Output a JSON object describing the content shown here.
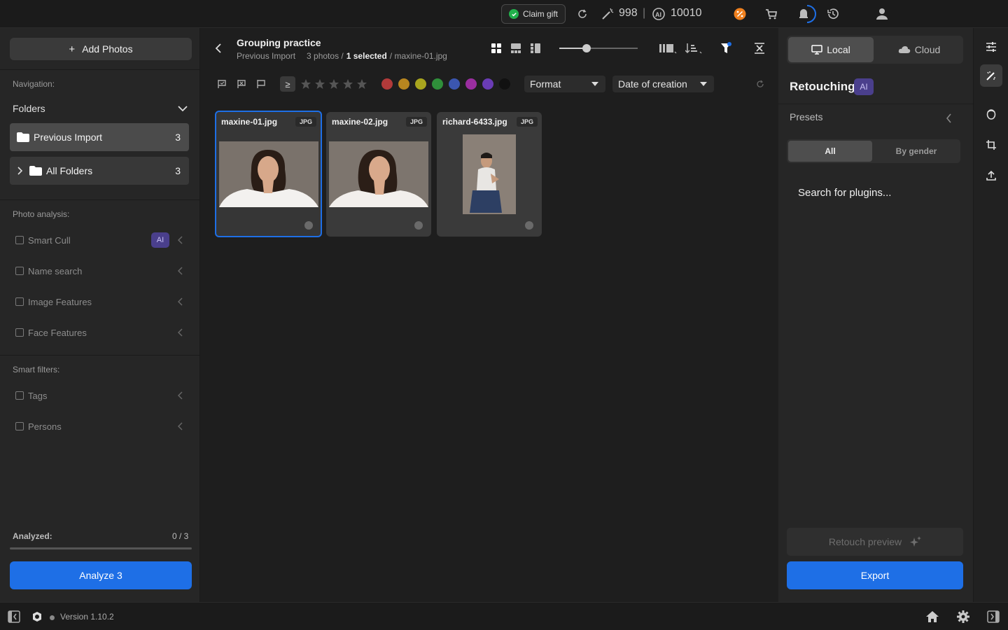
{
  "topbar": {
    "claim_gift": "Claim gift",
    "credits_magic": "998",
    "separator": "|",
    "credits_ai": "10010"
  },
  "left": {
    "add_photos": "Add Photos",
    "navigation_label": "Navigation:",
    "folders_label": "Folders",
    "folders": [
      {
        "label": "Previous Import",
        "count": "3"
      },
      {
        "label": "All Folders",
        "count": "3"
      }
    ],
    "photo_analysis_label": "Photo analysis:",
    "analysis_items": [
      {
        "label": "Smart Cull",
        "badge": "AI"
      },
      {
        "label": "Name search"
      },
      {
        "label": "Image Features"
      },
      {
        "label": "Face Features"
      }
    ],
    "smart_filters_label": "Smart filters:",
    "filter_items": [
      {
        "label": "Tags"
      },
      {
        "label": "Persons"
      }
    ],
    "analyzed_label": "Analyzed:",
    "analyzed_value": "0 / 3",
    "analyzed_progress": 0,
    "analyze_button": "Analyze 3"
  },
  "center": {
    "title": "Grouping practice",
    "breadcrumb_folder": "Previous Import",
    "photos_count": "3 photos /",
    "selected_count": "1 selected",
    "selected_file": "/ maxine-01.jpg",
    "ge_symbol": "≥",
    "format_dropdown": "Format",
    "sort_dropdown": "Date of creation",
    "color_labels": [
      "#b23a3a",
      "#b8861f",
      "#a8a51e",
      "#2f8f3a",
      "#3b56b0",
      "#9b2ea0",
      "#6a3cb5",
      "#111111"
    ],
    "photos": [
      {
        "name": "maxine-01.jpg",
        "format": "JPG",
        "selected": true
      },
      {
        "name": "maxine-02.jpg",
        "format": "JPG",
        "selected": false
      },
      {
        "name": "richard-6433.jpg",
        "format": "JPG",
        "selected": false
      }
    ]
  },
  "right": {
    "local_tab": "Local",
    "cloud_tab": "Cloud",
    "retouching_title": "Retouching",
    "retouching_badge": "AI",
    "presets_label": "Presets",
    "segment_all": "All",
    "segment_gender": "By gender",
    "search_plugins": "Search for plugins...",
    "retouch_preview": "Retouch preview",
    "export_button": "Export"
  },
  "bottombar": {
    "version": "Version 1.10.2"
  },
  "colors": {
    "accent_blue": "#1e6fe6",
    "ai_purple": "#4a3f8c",
    "claim_green": "#22b14c",
    "badge_orange": "#f0801e"
  }
}
